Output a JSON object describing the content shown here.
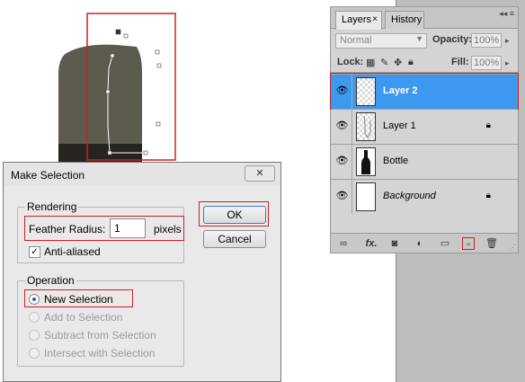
{
  "layers_panel": {
    "tabs": [
      {
        "label": "Layers",
        "close": "×"
      },
      {
        "label": "History"
      }
    ],
    "panel_menu": "◂◂ ≡",
    "blend_mode": "Normal",
    "opacity_label": "Opacity:",
    "opacity_value": "100%",
    "lock_label": "Lock:",
    "fill_label": "Fill:",
    "fill_value": "100%",
    "layers": [
      {
        "name": "Layer 2",
        "selected": true,
        "thumb": "transparent"
      },
      {
        "name": "Layer 1",
        "locked": true,
        "thumb": "transparent-with-path"
      },
      {
        "name": "Bottle",
        "thumb": "bottle"
      },
      {
        "name": "Background",
        "locked": true,
        "italic": true,
        "thumb": "white"
      }
    ],
    "bottom_icons": [
      "link-icon",
      "fx-icon",
      "mask-icon",
      "adjustment-icon",
      "folder-icon",
      "new-layer-icon",
      "trash-icon"
    ],
    "fx_text": "fx.",
    "accent_color": "#3d98f0",
    "highlight_color": "#cc2222"
  },
  "dialog": {
    "title": "Make Selection",
    "close": "✕",
    "rendering": {
      "label": "Rendering",
      "feather_label": "Feather Radius:",
      "feather_value": "1",
      "feather_unit": "pixels",
      "anti_aliased_label": "Anti-aliased",
      "anti_aliased_checked": true
    },
    "operation": {
      "label": "Operation",
      "options": [
        {
          "label": "New Selection",
          "checked": true,
          "enabled": true
        },
        {
          "label": "Add to Selection",
          "checked": false,
          "enabled": false
        },
        {
          "label": "Subtract from Selection",
          "checked": false,
          "enabled": false
        },
        {
          "label": "Intersect with Selection",
          "checked": false,
          "enabled": false
        }
      ]
    },
    "ok_label": "OK",
    "cancel_label": "Cancel"
  }
}
